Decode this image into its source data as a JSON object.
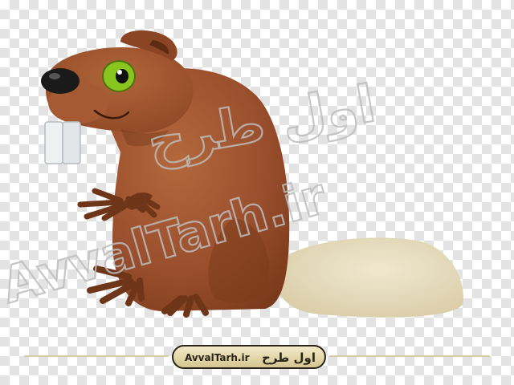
{
  "watermark": {
    "latin": "AvvalTarh.ir",
    "persian": "اول طرح"
  },
  "badge": {
    "latin": "AvvalTarh.ir",
    "persian": "اول طرح"
  },
  "colors": {
    "fur": "#9a4f2d",
    "fur_dark": "#6f3519",
    "tail": "#e6ddc1",
    "eye": "#88c61f",
    "nose": "#1a1a1a",
    "teeth": "#eef0f2",
    "badge_fill": "#e8dcb0"
  },
  "icons": {
    "subject": "beaver-illustration"
  }
}
